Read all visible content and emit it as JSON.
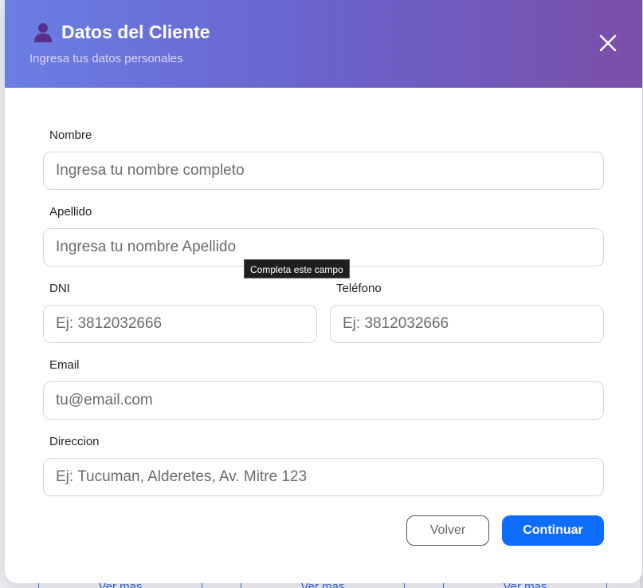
{
  "header": {
    "title": "Datos del Cliente",
    "subtitle": "Ingresa tus datos personales",
    "icon": "user-icon",
    "close_icon": "close-icon"
  },
  "form": {
    "nombre": {
      "label": "Nombre",
      "placeholder": "Ingresa tu nombre completo",
      "value": ""
    },
    "apellido": {
      "label": "Apellido",
      "placeholder": "Ingresa tu nombre Apellido",
      "value": ""
    },
    "dni": {
      "label": "DNI",
      "placeholder": "Ej: 3812032666",
      "value": ""
    },
    "telefono": {
      "label": "Teléfono",
      "placeholder": "Ej: 3812032666",
      "value": ""
    },
    "email": {
      "label": "Email",
      "placeholder": "tu@email.com",
      "value": ""
    },
    "direccion": {
      "label": "Direccion",
      "placeholder": "Ej: Tucuman, Alderetes, Av. Mitre 123",
      "value": ""
    }
  },
  "tooltip": {
    "text": "Completa este campo"
  },
  "actions": {
    "back_label": "Volver",
    "continue_label": "Continuar"
  },
  "background": {
    "card_link_label": "Ver mas"
  },
  "colors": {
    "header_gradient_start": "#6a7ee4",
    "header_gradient_end": "#7a4ea9",
    "primary": "#0d6efd"
  }
}
